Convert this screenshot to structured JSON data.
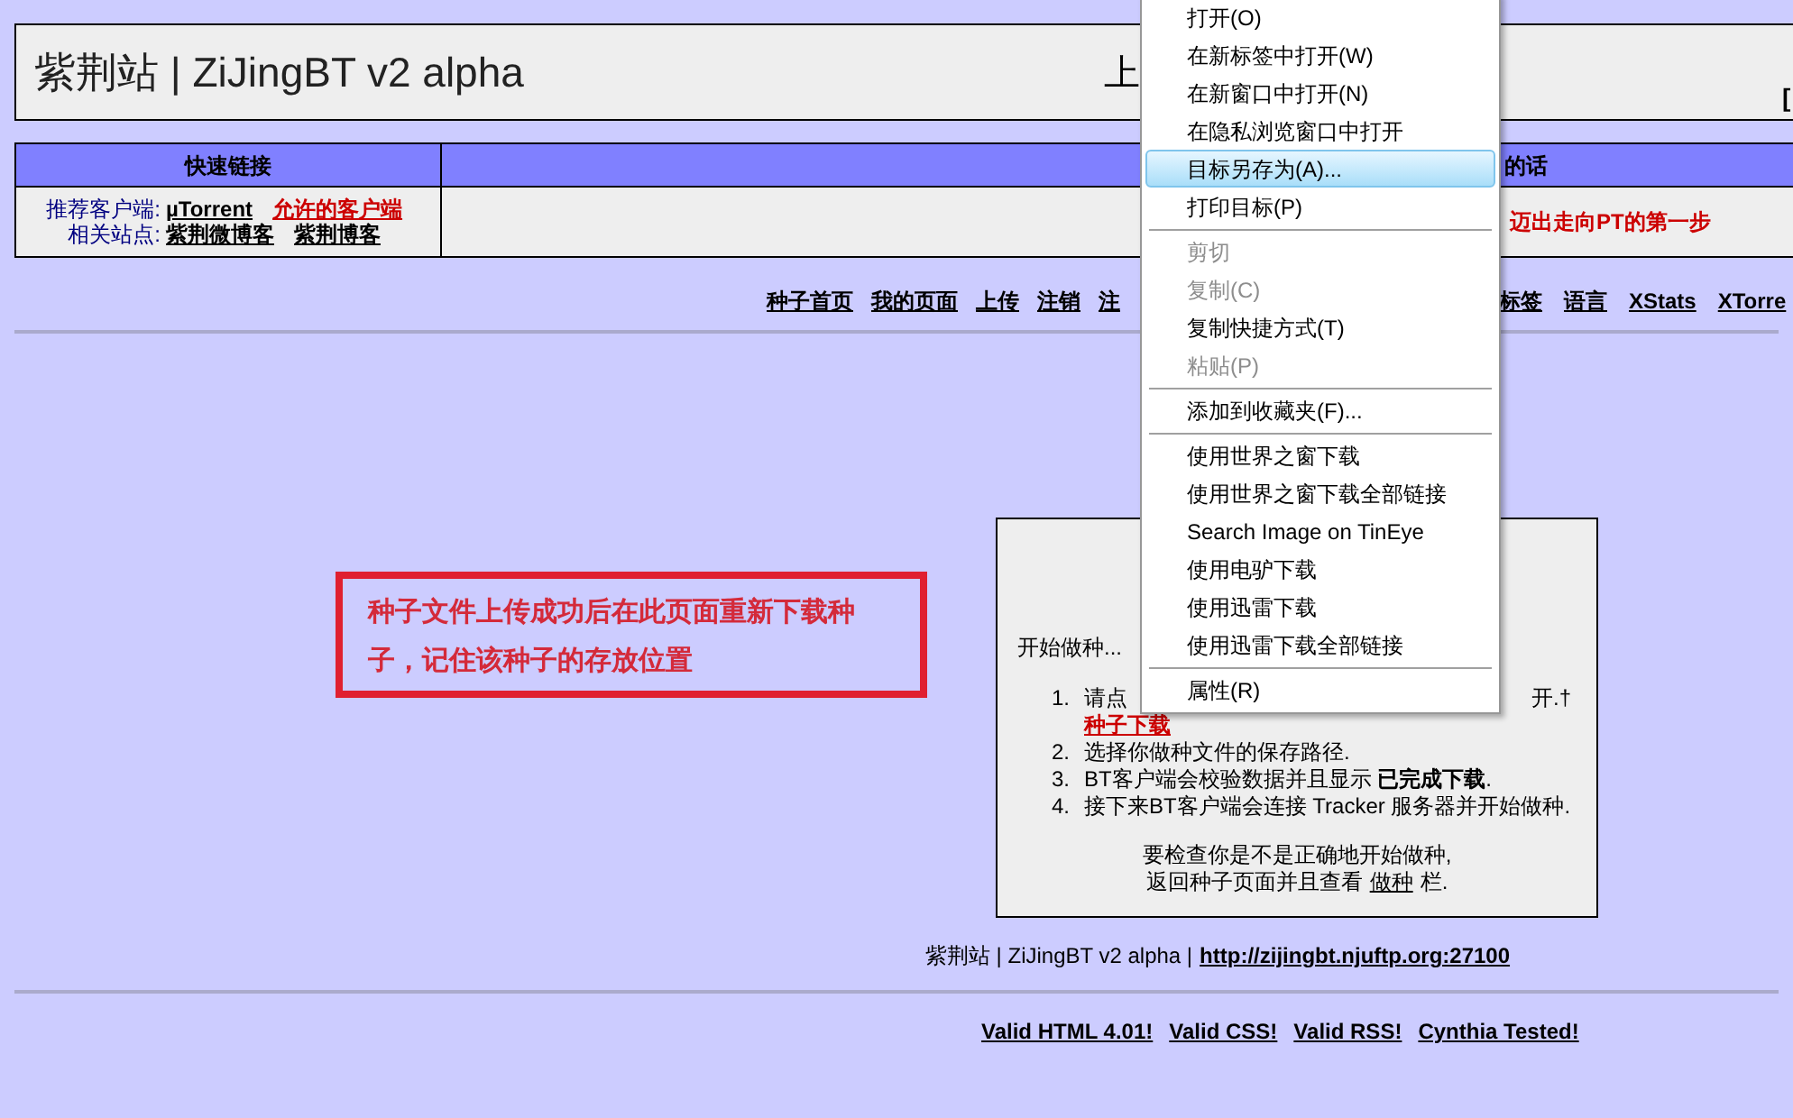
{
  "header": {
    "title": "紫荆站 | ZiJingBT v2 alpha",
    "right_top": "上",
    "right_bracket": "["
  },
  "quick_links": {
    "heading": "快速链接",
    "heading_2": "的话",
    "rows": [
      {
        "label": "推荐客户端:",
        "links": [
          {
            "text": "µTorrent",
            "kind": "normal"
          },
          {
            "text": "允许的客户端",
            "kind": "red"
          }
        ]
      },
      {
        "label": "相关站点:",
        "links": [
          {
            "text": "紫荆微博客",
            "kind": "normal"
          },
          {
            "text": "紫荆博客",
            "kind": "normal"
          }
        ]
      }
    ],
    "slogan": "迈出走向PT的第一步"
  },
  "nav_left": [
    "种子首页",
    "我的页面",
    "上传",
    "注销",
    "注"
  ],
  "nav_right": [
    "标签",
    "语言",
    "XStats",
    "XTorre"
  ],
  "annotation": "种子文件上传成功后在此页面重新下载种子，记住该种子的存放位置",
  "seed_box": {
    "intro": "开始做种...",
    "steps": [
      {
        "start": "请点",
        "end": "开.†",
        "link": "种子下载"
      },
      {
        "text": "选择你做种文件的保存路径."
      },
      {
        "text": "BT客户端会校验数据并且显示 **已完成下载**."
      },
      {
        "text": "接下来BT客户端会连接 Tracker 服务器并开始做种."
      }
    ],
    "numbers": [
      "1.",
      "2.",
      "3.",
      "4."
    ],
    "check_line": "要检查你是不是正确地开始做种,",
    "back_prefix": "返回种子页面并且查看",
    "back_link": "做种",
    "back_suffix": "栏."
  },
  "footer": {
    "text": "紫荆站 | ZiJingBT v2 alpha |",
    "link": "http://zijingbt.njuftp.org:27100"
  },
  "validators": [
    "Valid HTML 4.01!",
    "Valid CSS!",
    "Valid RSS!",
    "Cynthia Tested!"
  ],
  "context_menu": [
    {
      "kind": "item",
      "label": "打开(O)",
      "disabled": false,
      "selected": false
    },
    {
      "kind": "item",
      "label": "在新标签中打开(W)",
      "disabled": false,
      "selected": false
    },
    {
      "kind": "item",
      "label": "在新窗口中打开(N)",
      "disabled": false,
      "selected": false
    },
    {
      "kind": "item",
      "label": "在隐私浏览窗口中打开",
      "disabled": false,
      "selected": false
    },
    {
      "kind": "item",
      "label": "目标另存为(A)...",
      "disabled": false,
      "selected": true
    },
    {
      "kind": "item",
      "label": "打印目标(P)",
      "disabled": false,
      "selected": false
    },
    {
      "kind": "separator"
    },
    {
      "kind": "item",
      "label": "剪切",
      "disabled": true,
      "selected": false
    },
    {
      "kind": "item",
      "label": "复制(C)",
      "disabled": true,
      "selected": false
    },
    {
      "kind": "item",
      "label": "复制快捷方式(T)",
      "disabled": false,
      "selected": false
    },
    {
      "kind": "item",
      "label": "粘贴(P)",
      "disabled": true,
      "selected": false
    },
    {
      "kind": "separator"
    },
    {
      "kind": "item",
      "label": "添加到收藏夹(F)...",
      "disabled": false,
      "selected": false
    },
    {
      "kind": "separator"
    },
    {
      "kind": "item",
      "label": "使用世界之窗下载",
      "disabled": false,
      "selected": false
    },
    {
      "kind": "item",
      "label": "使用世界之窗下载全部链接",
      "disabled": false,
      "selected": false
    },
    {
      "kind": "item",
      "label": "Search Image on TinEye",
      "disabled": false,
      "selected": false
    },
    {
      "kind": "item",
      "label": "使用电驴下载",
      "disabled": false,
      "selected": false
    },
    {
      "kind": "item",
      "label": "使用迅雷下载",
      "disabled": false,
      "selected": false
    },
    {
      "kind": "item",
      "label": "使用迅雷下载全部链接",
      "disabled": false,
      "selected": false
    },
    {
      "kind": "separator"
    },
    {
      "kind": "item",
      "label": "属性(R)",
      "disabled": false,
      "selected": false
    }
  ]
}
